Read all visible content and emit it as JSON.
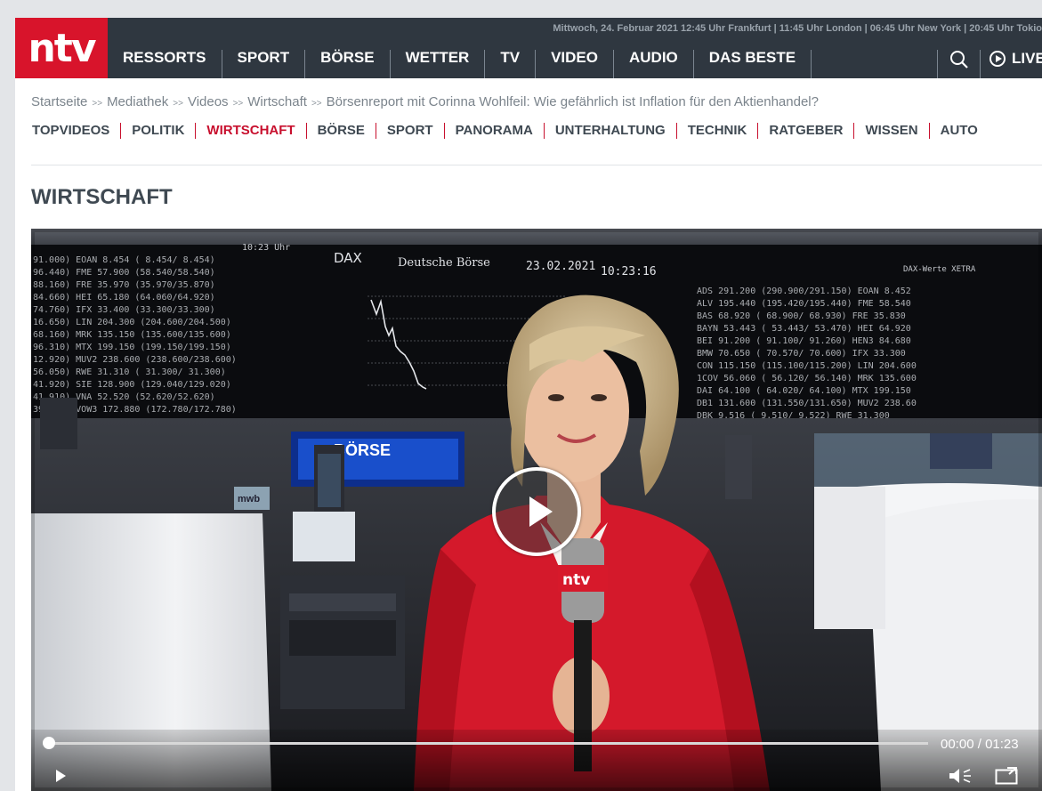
{
  "header": {
    "logo_text": "ntv",
    "dateline": "Mittwoch, 24. Februar 2021 12:45 Uhr Frankfurt | 11:45 Uhr London | 06:45 Uhr New York | 20:45 Uhr Tokio",
    "nav": [
      "RESSORTS",
      "SPORT",
      "BÖRSE",
      "WETTER",
      "TV",
      "VIDEO",
      "AUDIO",
      "DAS BESTE"
    ],
    "live_label": "LIVE",
    "brand_color": "#d8142b",
    "bar_color": "#2f3740"
  },
  "breadcrumb": [
    "Startseite",
    "Mediathek",
    "Videos",
    "Wirtschaft",
    "Börsenreport mit Corinna Wohlfeil: Wie gefährlich ist Inflation für den Aktienhandel?"
  ],
  "subnav": {
    "items": [
      "TOPVIDEOS",
      "POLITIK",
      "WIRTSCHAFT",
      "BÖRSE",
      "SPORT",
      "PANORAMA",
      "UNTERHALTUNG",
      "TECHNIK",
      "RATGEBER",
      "WISSEN",
      "AUTO"
    ],
    "active": "WIRTSCHAFT",
    "accent_color": "#c8102e"
  },
  "section_title": "WIRTSCHAFT",
  "video": {
    "board_title": "DAX",
    "board_sub": "Deutsche Börse",
    "board_date": "23.02.2021",
    "board_clock": "10:23:16",
    "board_time_top": "10:23 Uhr",
    "sign_text": "BÖRSE",
    "mic_logo": "ntv",
    "desk_label": "mwb",
    "current_time": "00:00",
    "duration": "01:23",
    "progress": 0
  },
  "icons": {
    "search": "search-icon",
    "live": "play-circle-icon",
    "play": "play-icon",
    "volume": "volume-icon",
    "fullscreen": "fullscreen-icon"
  }
}
